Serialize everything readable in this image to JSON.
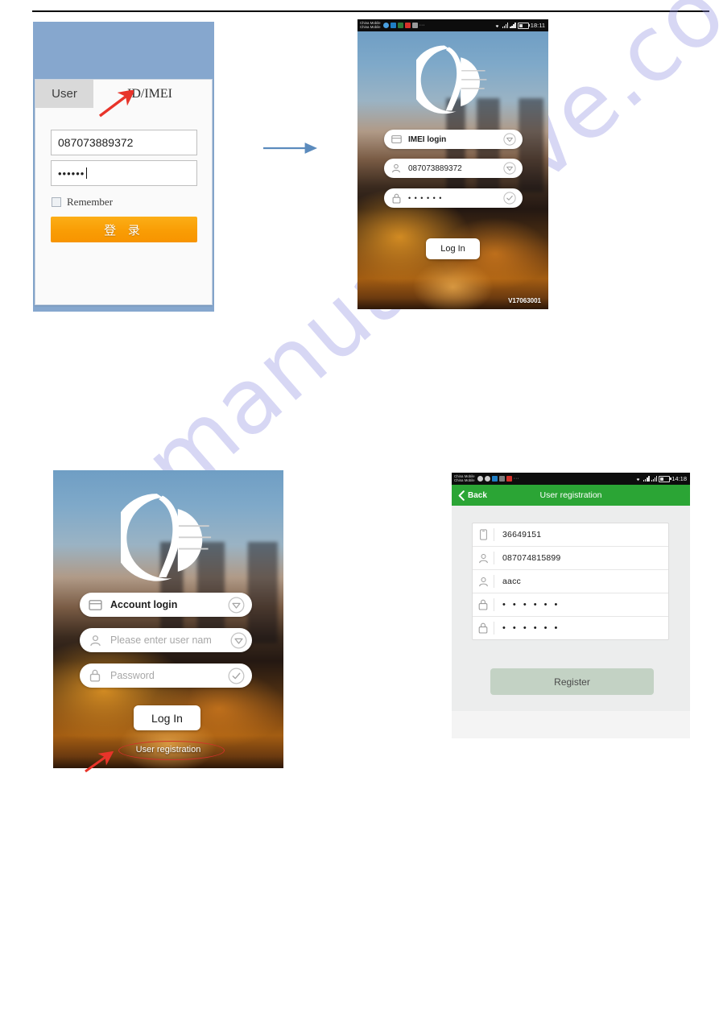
{
  "page": {
    "watermark": "manualshive.com"
  },
  "web_login": {
    "tabs": [
      {
        "label": "User",
        "active": true
      },
      {
        "label": "ID/IMEI",
        "active": false
      }
    ],
    "account_value": "087073889372",
    "password_value": "••••••",
    "remember_label": "Remember",
    "submit_label": "登 录"
  },
  "phone_imei_login": {
    "status_bar": {
      "carrier_line1": "China Mobile",
      "carrier_line2": "China Mobile",
      "time": "18:11"
    },
    "mode_row": {
      "label": "IMEI login",
      "icon": "card-icon",
      "trailing": "chevron-down-icon"
    },
    "account_row": {
      "value": "087073889372",
      "icon": "user-icon",
      "trailing": "chevron-down-icon"
    },
    "password_row": {
      "value": "• • • • • •",
      "icon": "lock-icon",
      "trailing": "check-icon"
    },
    "login_button": "Log In",
    "version": "V17063001"
  },
  "phone_account_login": {
    "mode_row": {
      "label": "Account login",
      "icon": "card-icon",
      "trailing": "chevron-down-icon"
    },
    "account_row": {
      "placeholder": "Please enter user nam",
      "icon": "user-icon",
      "trailing": "chevron-down-icon"
    },
    "password_row": {
      "placeholder": "Password",
      "icon": "lock-icon",
      "trailing": "check-icon"
    },
    "login_button": "Log In",
    "registration_link": "User registration"
  },
  "phone_registration": {
    "status_bar": {
      "carrier_line1": "China Mobile",
      "carrier_line2": "China Mobile",
      "time": "14:18"
    },
    "back_label": "Back",
    "title": "User registration",
    "fields": [
      {
        "icon": "device-icon",
        "value": "36649151",
        "masked": false
      },
      {
        "icon": "user-icon",
        "value": "087074815899",
        "masked": false
      },
      {
        "icon": "user-icon",
        "value": "aacc",
        "masked": false
      },
      {
        "icon": "lock-icon",
        "value": "• • • • • •",
        "masked": true
      },
      {
        "icon": "lock-icon",
        "value": "• • • • • •",
        "masked": true
      }
    ],
    "register_button": "Register",
    "accent_color": "#2ba535",
    "button_color": "#c3d2c4"
  }
}
